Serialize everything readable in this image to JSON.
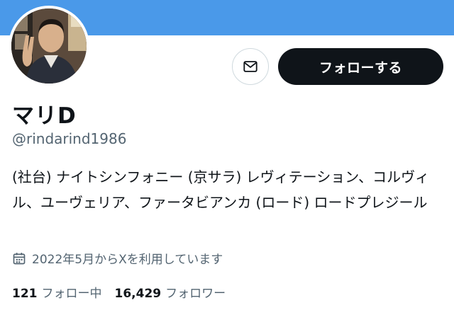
{
  "profile": {
    "display_name": "マリD",
    "handle": "@rindarind1986",
    "bio": "(社台) ナイトシンフォニー (京サラ) レヴィテーション、コルヴィル、ユーヴェリア、ファータビアンカ (ロード) ロードプレジール",
    "joined": "2022年5月からXを利用しています"
  },
  "actions": {
    "follow_label": "フォローする",
    "message_icon": "envelope-icon"
  },
  "stats": {
    "following_count": "121",
    "following_label": "フォロー中",
    "followers_count": "16,429",
    "followers_label": "フォロワー"
  },
  "colors": {
    "banner": "#4a99e9",
    "button_dark": "#0f1419",
    "secondary_text": "#536471"
  },
  "icons": {
    "joined": "calendar-icon"
  }
}
